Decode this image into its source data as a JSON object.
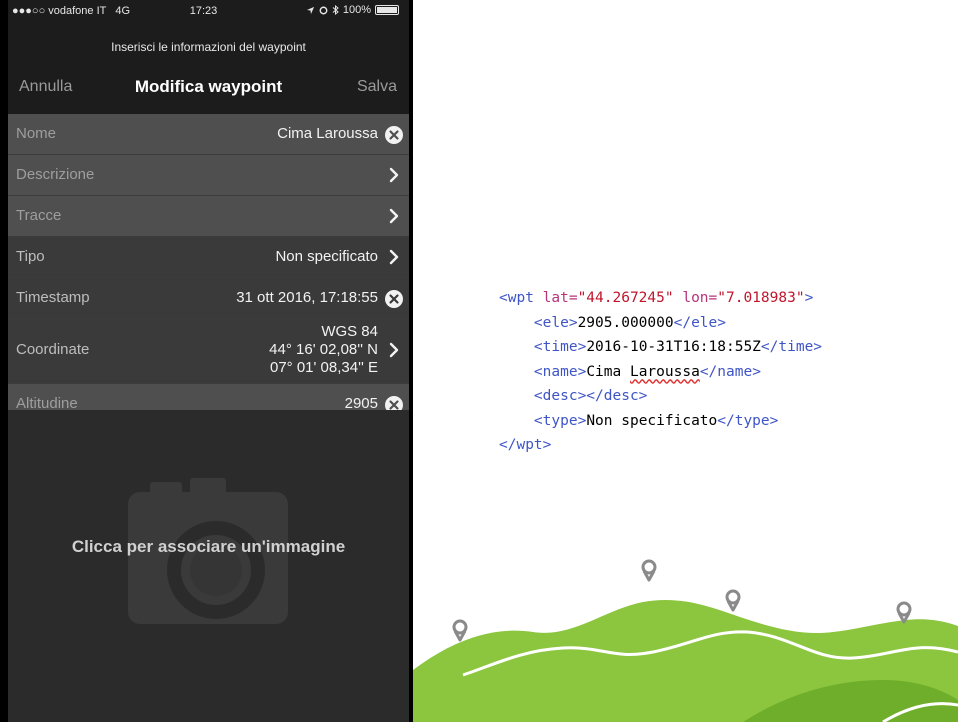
{
  "status_bar": {
    "carrier": "●●●○○ vodafone IT",
    "network": "4G",
    "time": "17:23",
    "battery": "100%"
  },
  "nav": {
    "prompt": "Inserisci le informazioni del waypoint",
    "cancel": "Annulla",
    "title": "Modifica waypoint",
    "save": "Salva"
  },
  "fields": {
    "nome": {
      "label": "Nome",
      "value": "Cima Laroussa"
    },
    "descrizione": {
      "label": "Descrizione"
    },
    "tracce": {
      "label": "Tracce"
    },
    "tipo": {
      "label": "Tipo",
      "value": "Non specificato"
    },
    "timestamp": {
      "label": "Timestamp",
      "value": "31 ott 2016, 17:18:55"
    },
    "coordinate": {
      "label": "Coordinate",
      "datum": "WGS 84",
      "lat": "44° 16' 02,08'' N",
      "lon": "07° 01' 08,34'' E"
    },
    "altitudine": {
      "label": "Altitudine",
      "value": "2905"
    }
  },
  "image": {
    "prompt": "Clicca per associare un'immagine"
  },
  "xml": {
    "wpt_open": "<wpt",
    "lat_attr": "lat=",
    "lat_val": "\"44.267245\"",
    "lon_attr": "lon=",
    "lon_val": "\"7.018983\"",
    "wpt_open_end": ">",
    "ele_open": "<ele>",
    "ele_val": "2905.000000",
    "ele_close": "</ele>",
    "time_open": "<time>",
    "time_val": "2016-10-31T16:18:55Z",
    "time_close": "</time>",
    "name_open": "<name>",
    "name_val_a": "Cima ",
    "name_val_b": "Laroussa",
    "name_close": "</name>",
    "desc": "<desc></desc>",
    "type_open": "<type>",
    "type_val": "Non specificato",
    "type_close": "</type>",
    "wpt_close": "</wpt>"
  },
  "colors": {
    "phone_bg": "#2b2b2b",
    "nav_bg": "#1c1c1c",
    "row_light": "#4f4f4f",
    "row_dark": "#3a3a3a",
    "xml_tag": "#3f55c6",
    "xml_attr": "#b5347a",
    "xml_string": "#c0162d",
    "hill_green": "#8cc63f"
  }
}
